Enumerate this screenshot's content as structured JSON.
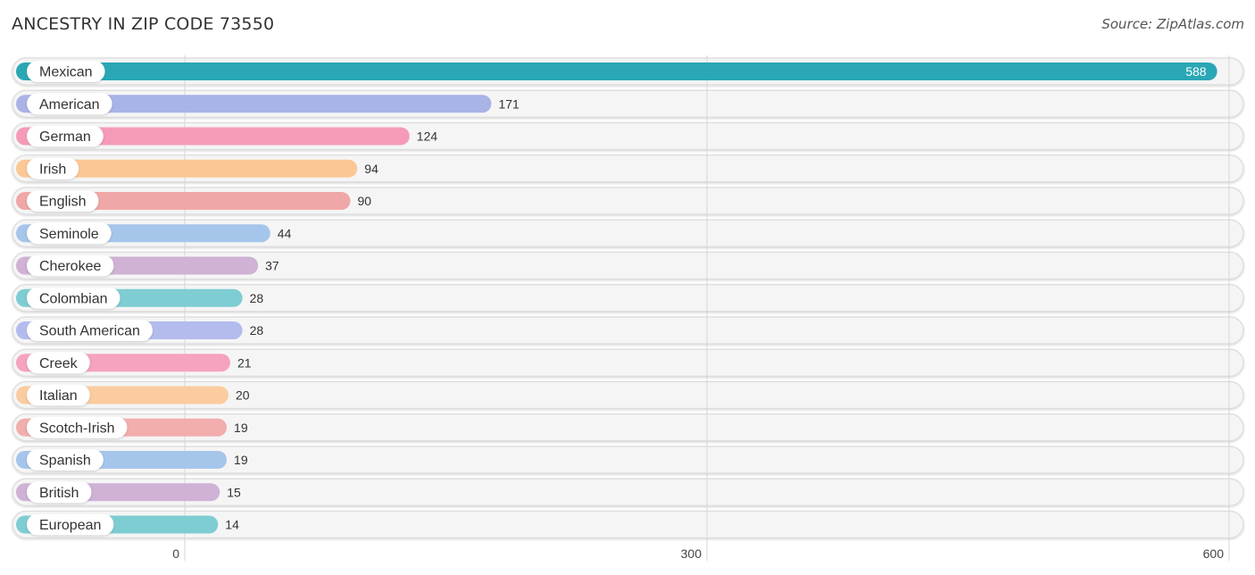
{
  "header": {
    "title": "ANCESTRY IN ZIP CODE 73550",
    "source": "Source: ZipAtlas.com"
  },
  "chart_data": {
    "type": "bar",
    "orientation": "horizontal",
    "title": "ANCESTRY IN ZIP CODE 73550",
    "xlabel": "",
    "ylabel": "",
    "xlim": [
      0,
      600
    ],
    "xticks": [
      0,
      300,
      600
    ],
    "grid": true,
    "categories": [
      "Mexican",
      "American",
      "German",
      "Irish",
      "English",
      "Seminole",
      "Cherokee",
      "Colombian",
      "South American",
      "Creek",
      "Italian",
      "Scotch-Irish",
      "Spanish",
      "British",
      "European"
    ],
    "values": [
      588,
      171,
      124,
      94,
      90,
      44,
      37,
      28,
      28,
      21,
      20,
      19,
      19,
      15,
      14
    ],
    "colors": [
      "#2aa7b5",
      "#a9b3e6",
      "#f59bb7",
      "#fbc895",
      "#f0a7a7",
      "#a6c5ea",
      "#cfb2d4",
      "#7ecdd2",
      "#b4bcee",
      "#f5a3bf",
      "#fbcca0",
      "#f2adad",
      "#a6c5ea",
      "#cfb2d6",
      "#7ecdd2"
    ],
    "value_label_inside": [
      true,
      false,
      false,
      false,
      false,
      false,
      false,
      false,
      false,
      false,
      false,
      false,
      false,
      false,
      false
    ]
  }
}
